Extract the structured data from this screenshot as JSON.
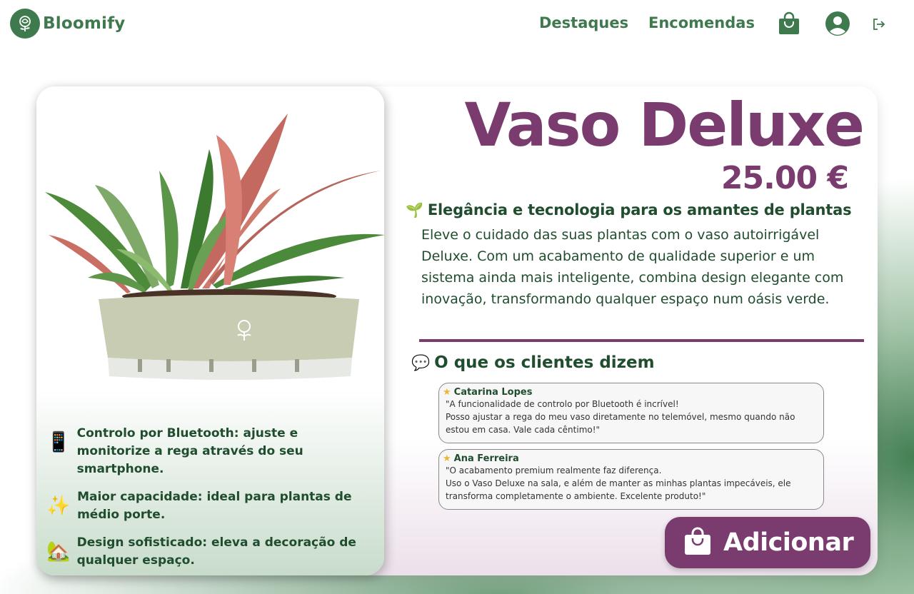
{
  "header": {
    "brand": "Bloomify",
    "nav": [
      "Destaques",
      "Encomendas"
    ]
  },
  "product": {
    "title": "Vaso Deluxe",
    "price": "25.00 €",
    "tagline": "Elegância e tecnologia para os amantes de plantas",
    "tagline_icon": "🌱",
    "description": "Eleve o cuidado das suas plantas com o vaso autoirrigável Deluxe. Com um acabamento de qualidade superior e um sistema ainda mais inteligente, combina design elegante com inovação, transformando qualquer espaço num oásis verde.",
    "features": [
      {
        "icon": "📱",
        "text": "Controlo por Bluetooth: ajuste e monitorize a rega através do seu smartphone."
      },
      {
        "icon": "✨",
        "text": "Maior capacidade: ideal para plantas de médio porte."
      },
      {
        "icon": "🏡",
        "text": "Design sofisticado: eleva a decoração de qualquer espaço."
      }
    ]
  },
  "reviews": {
    "heading": "O que os clientes dizem",
    "heading_icon": "💬",
    "items": [
      {
        "author": "Catarina Lopes",
        "lines": [
          "\"A funcionalidade de controlo por Bluetooth é incrível!",
          "Posso ajustar a rega do meu vaso diretamente no telemóvel, mesmo quando não",
          "estou em casa. Vale cada cêntimo!\""
        ]
      },
      {
        "author": "Ana Ferreira",
        "lines": [
          "\"O acabamento premium realmente faz diferença.",
          "Uso o Vaso Deluxe na sala, e além de manter as minhas plantas impecáveis, ele",
          "transforma completamente o ambiente. Excelente produto!\""
        ]
      }
    ]
  },
  "cta": {
    "label": "Adicionar"
  },
  "colors": {
    "brand_green": "#3f7a4f",
    "accent_purple": "#7a3b6e",
    "text_green": "#1f4d2e"
  }
}
